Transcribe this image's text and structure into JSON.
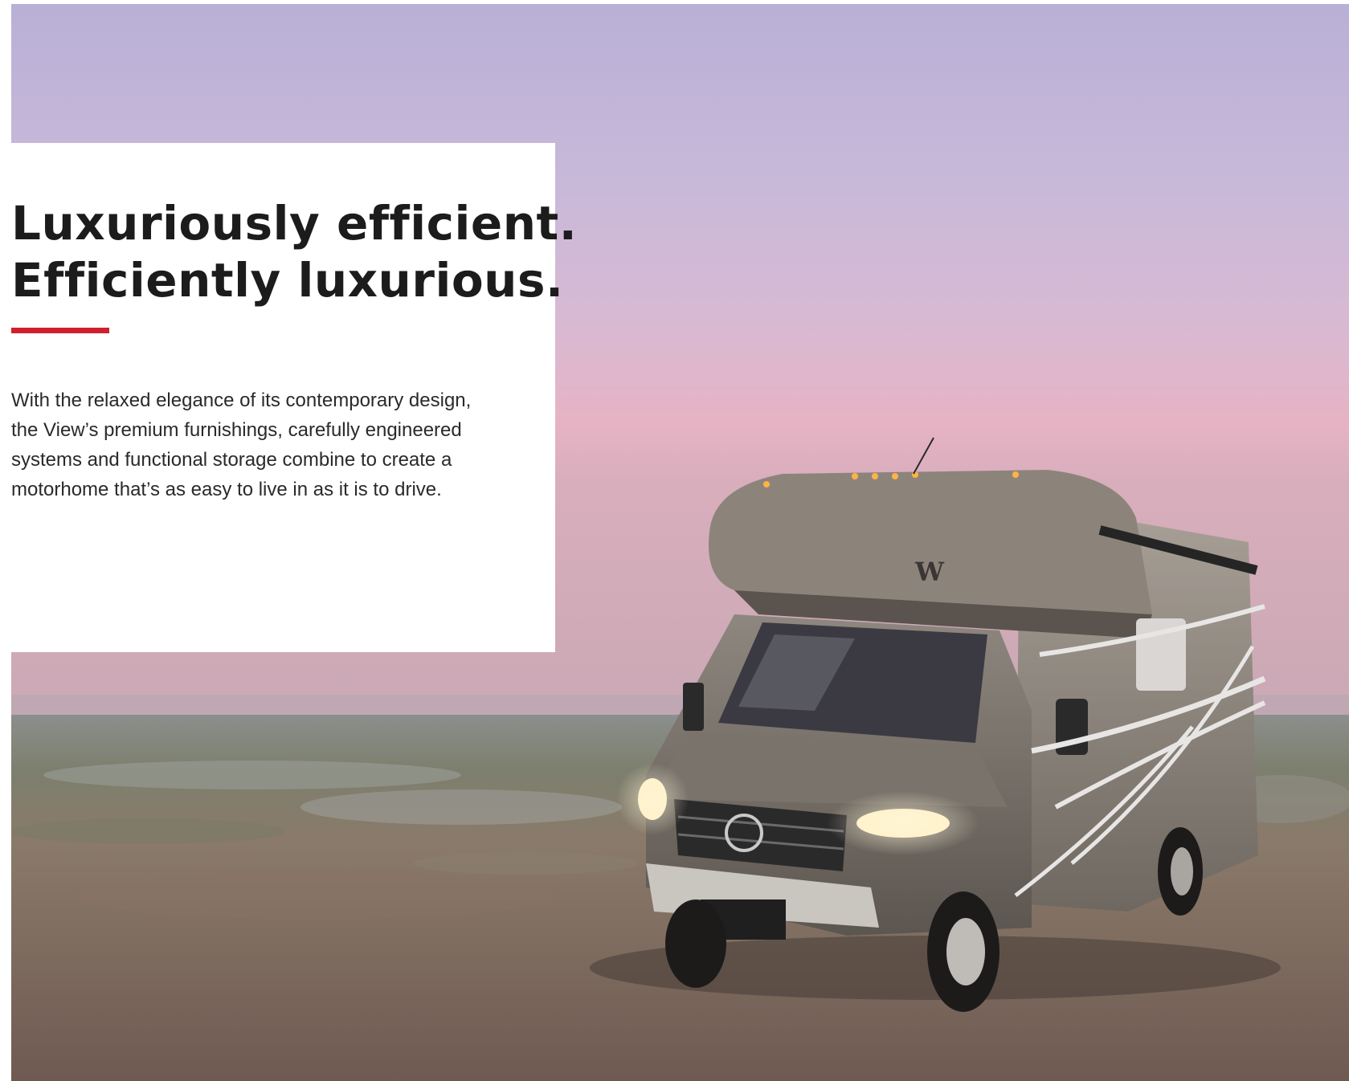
{
  "headline": {
    "line1": "Luxuriously efficient.",
    "line2": "Efficiently luxurious."
  },
  "body": {
    "line1": "With the relaxed elegance of its contemporary design,",
    "line2": "the View’s premium furnishings, carefully engineered",
    "line3": "systems and functional storage combine to create a",
    "line4": "motorhome that’s as easy to live in as it is to drive."
  },
  "colors": {
    "accent_rule": "#d0202e",
    "headline_text": "#1c1c1c",
    "body_text": "#2a2a2a",
    "panel_background": "#ffffff"
  },
  "hero_image": {
    "subject": "motorhome-at-dusk-photo",
    "brand_badge": "W"
  }
}
